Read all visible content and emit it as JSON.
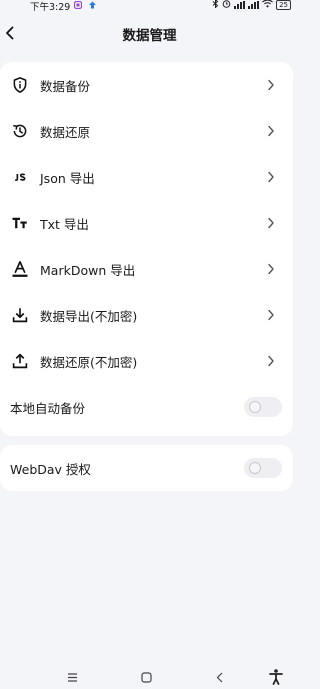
{
  "status_bar": {
    "time": "下午3:29",
    "battery": "25"
  },
  "header": {
    "title": "数据管理"
  },
  "menu_items": [
    {
      "label": "数据备份",
      "icon": "shield-info-icon"
    },
    {
      "label": "数据还原",
      "icon": "history-restore-icon"
    },
    {
      "label": "Json 导出",
      "icon": "js-icon"
    },
    {
      "label": "Txt 导出",
      "icon": "text-format-icon"
    },
    {
      "label": "MarkDown 导出",
      "icon": "format-color-text-icon"
    },
    {
      "label": "数据导出(不加密)",
      "icon": "download-icon"
    },
    {
      "label": "数据还原(不加密)",
      "icon": "upload-icon"
    }
  ],
  "toggles": {
    "auto_backup": {
      "label": "本地自动备份",
      "enabled": false
    },
    "webdav": {
      "label": "WebDav 授权",
      "enabled": false
    }
  },
  "nav_bar": {
    "items": [
      "menu-icon",
      "home-square-icon",
      "back-icon",
      "accessibility-icon"
    ]
  }
}
